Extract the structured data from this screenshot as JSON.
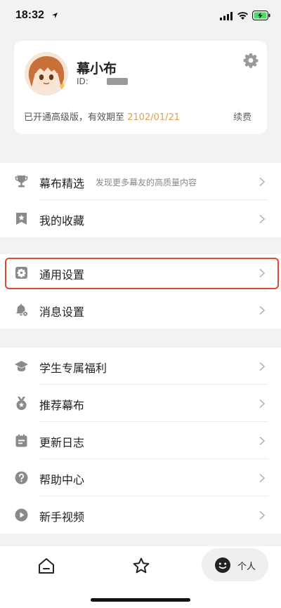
{
  "status_bar": {
    "time": "18:32"
  },
  "profile": {
    "name": "幕小布",
    "id_label": "ID:",
    "vip_text": "已开通高级版，有效期至 ",
    "vip_date": "2102/01/21",
    "renew_label": "续费"
  },
  "group1": [
    {
      "label": "幕布精选",
      "sub": "发现更多幕友的高质量内容",
      "icon": "trophy-icon"
    },
    {
      "label": "我的收藏",
      "icon": "bookmark-star-icon"
    }
  ],
  "group2": [
    {
      "label": "通用设置",
      "icon": "settings-gear-icon"
    },
    {
      "label": "消息设置",
      "icon": "bell-settings-icon"
    }
  ],
  "group3": [
    {
      "label": "学生专属福利",
      "icon": "graduation-cap-icon"
    },
    {
      "label": "推荐幕布",
      "icon": "medal-icon"
    },
    {
      "label": "更新日志",
      "icon": "calendar-list-icon"
    },
    {
      "label": "帮助中心",
      "icon": "help-circle-icon"
    },
    {
      "label": "新手视频",
      "icon": "play-circle-icon"
    }
  ],
  "tabbar": {
    "home_icon": "home-icon",
    "star_icon": "star-icon",
    "me_label": "个人"
  },
  "colors": {
    "accent_date": "#e3a04e",
    "highlight_border": "#e04a2c",
    "icon_gray": "#8a8a8a"
  }
}
